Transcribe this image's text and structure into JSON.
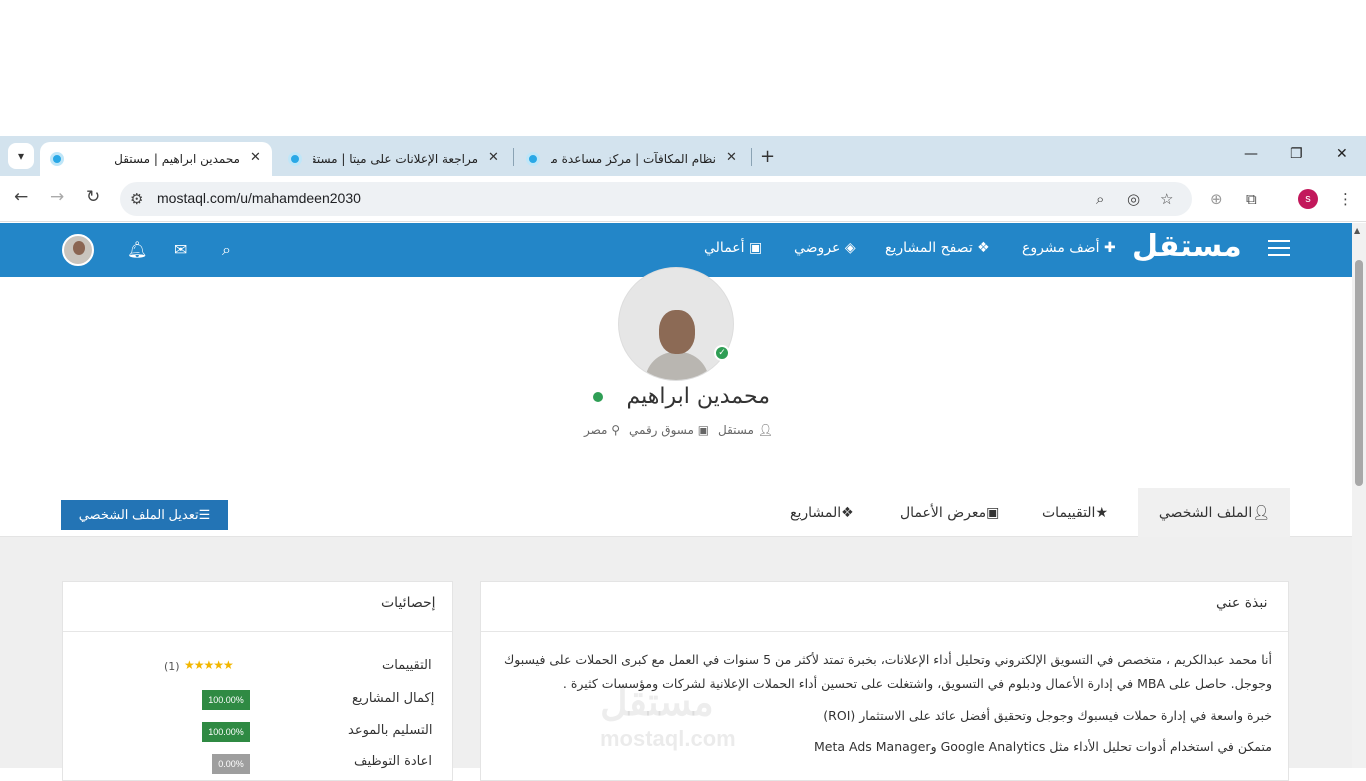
{
  "browser": {
    "tabs": [
      {
        "title": "محمدين ابراهيم | مستقل",
        "active": true
      },
      {
        "title": "مراجعة الإعلانات على ميتا | مستقل",
        "active": false
      },
      {
        "title": "نظام المكافآت | مركز مساعدة مستقل",
        "active": false
      }
    ],
    "url": "mostaql.com/u/mahamdeen2030",
    "profile_initial": "s"
  },
  "header": {
    "logo": "مستقل",
    "nav": {
      "add_project": "أضف مشروع",
      "browse_projects": "تصفح المشاريع",
      "my_bids": "عروضي",
      "my_works": "أعمالي"
    }
  },
  "profile": {
    "name": "محمدين ابراهيم",
    "role": "مستقل",
    "title": "مسوق رقمي",
    "country": "مصر"
  },
  "tabs": {
    "profile": "الملف الشخصي",
    "reviews": "التقييمات",
    "portfolio": "معرض الأعمال",
    "projects": "المشاريع"
  },
  "edit_button": "تعديل الملف الشخصي",
  "about": {
    "title": "نبذة عني",
    "p1": "أنا محمد عبدالكريم ، متخصص في التسويق الإلكتروني وتحليل أداء الإعلانات، بخبرة تمتد لأكثر من 5 سنوات في العمل مع كبرى الحملات على فيسبوك وجوجل. حاصل على MBA في إدارة الأعمال ودبلوم في التسويق، واشتغلت على تحسين أداء الحملات الإعلانية لشركات ومؤسسات كثيرة .",
    "p2": "خبرة واسعة في إدارة حملات فيسبوك وجوجل وتحقيق أفضل عائد على الاستثمار (ROI)",
    "p3": "متمكن في استخدام أدوات تحليل الأداء مثل Google Analytics وMeta Ads Manager",
    "watermark": "مستقل",
    "watermark_domain": "mostaql.com"
  },
  "stats": {
    "title": "إحصائيات",
    "reviews_label": "التقييمات",
    "reviews_count": "(1)",
    "rating": 5,
    "completion_label": "إكمال المشاريع",
    "completion_value": "100.00%",
    "on_time_label": "التسليم بالموعد",
    "on_time_value": "100.00%",
    "rehire_label": "اعادة التوظيف",
    "rehire_value": "0.00%"
  },
  "colors": {
    "brand_blue": "#2386c8",
    "button_blue": "#2374b5",
    "success_green": "#2f8a43",
    "muted_gray": "#9e9e9e",
    "star_gold": "#f2b600"
  }
}
